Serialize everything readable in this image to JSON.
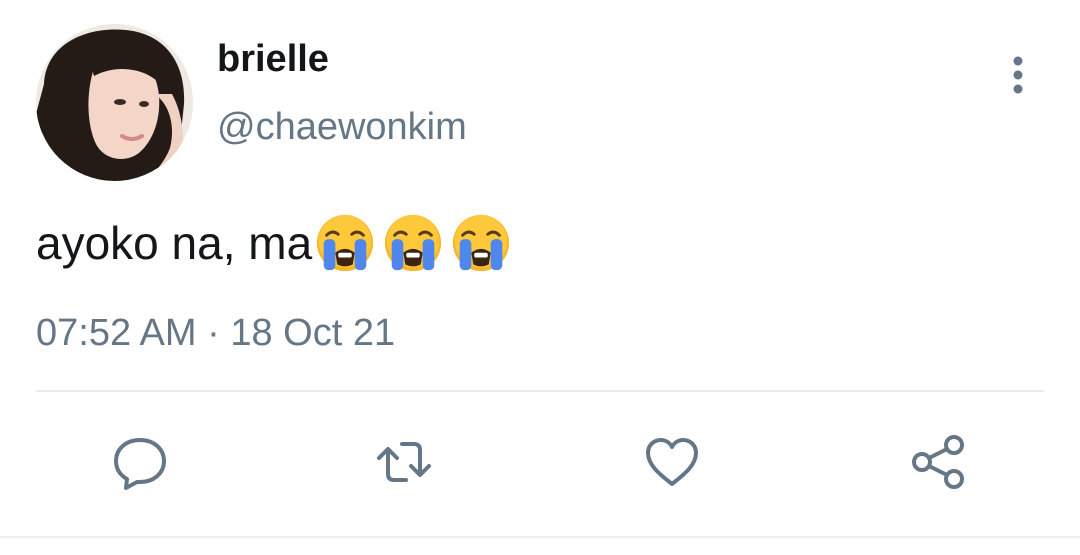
{
  "tweet": {
    "display_name": "brielle",
    "handle": "@chaewonkim",
    "text": "ayoko na, ma",
    "emojis": [
      "loudly-crying-face",
      "loudly-crying-face",
      "loudly-crying-face"
    ],
    "timestamp": "07:52 AM · 18 Oct 21"
  },
  "actions": {
    "reply_icon": "reply-icon",
    "retweet_icon": "retweet-icon",
    "like_icon": "heart-icon",
    "share_icon": "share-icon"
  },
  "colors": {
    "text_primary": "#14171a",
    "text_secondary": "#657786",
    "icon": "#657786",
    "divider": "#e6ecf0"
  }
}
